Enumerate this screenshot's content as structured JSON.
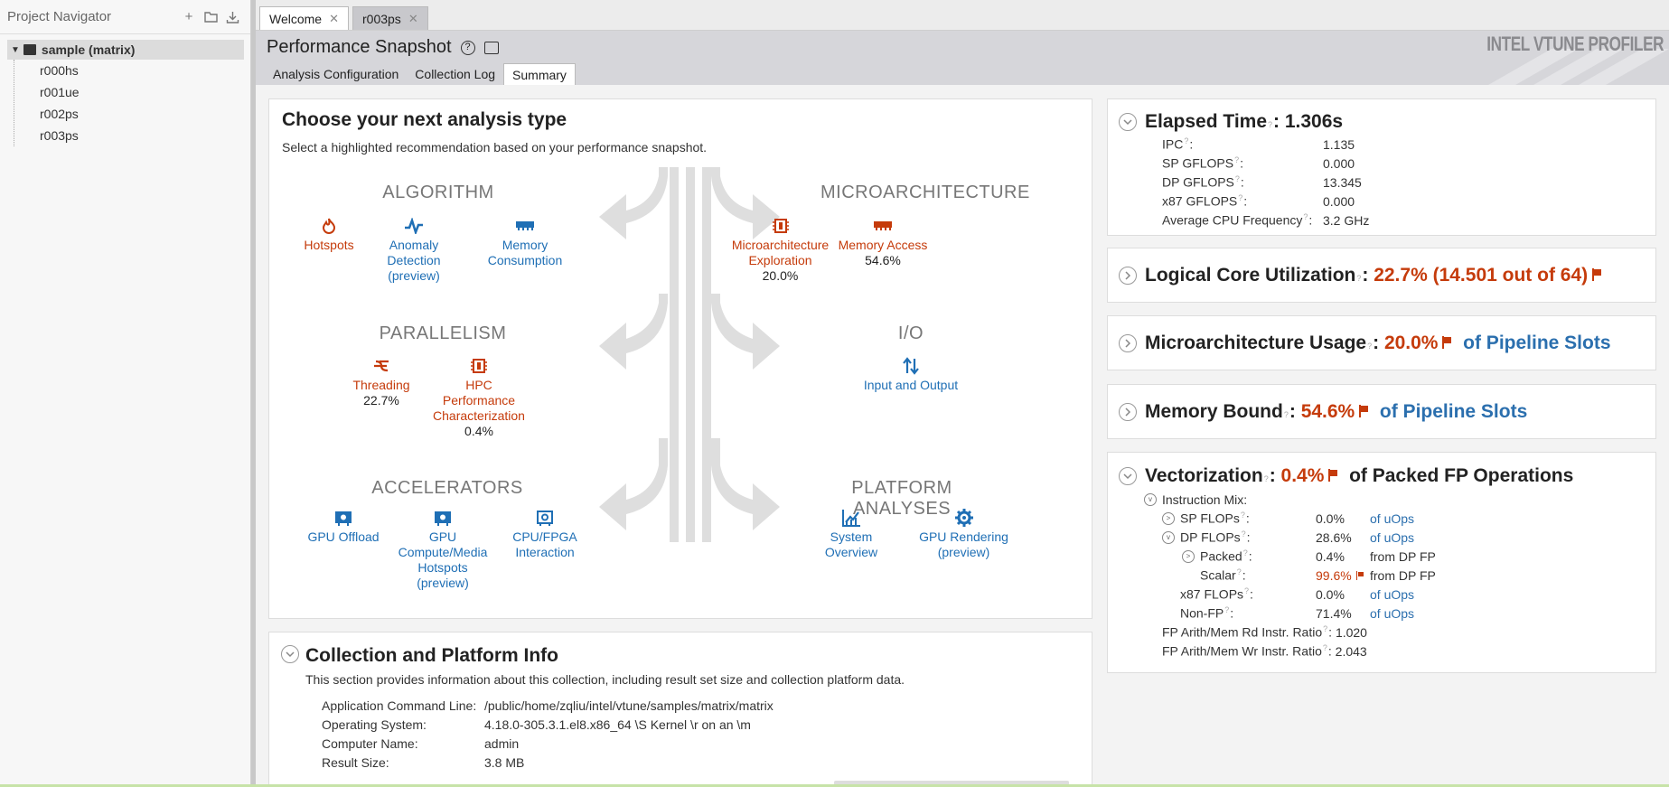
{
  "navigator": {
    "title": "Project Navigator",
    "project": "sample (matrix)",
    "results": [
      "r000hs",
      "r001ue",
      "r002ps",
      "r003ps"
    ]
  },
  "tabs": [
    {
      "label": "Welcome",
      "active": false
    },
    {
      "label": "r003ps",
      "active": true
    }
  ],
  "header": {
    "title": "Performance Snapshot",
    "brand": "INTEL VTUNE PROFILER",
    "subtabs": [
      "Analysis Configuration",
      "Collection Log",
      "Summary"
    ],
    "active_subtab": "Summary"
  },
  "choose": {
    "title": "Choose your next analysis type",
    "subtitle": "Select a highlighted recommendation based on your performance snapshot.",
    "categories": {
      "algorithm": "ALGORITHM",
      "microarchitecture": "MICROARCHITECTURE",
      "parallelism": "PARALLELISM",
      "io": "I/O",
      "accelerators": "ACCELERATORS",
      "platform": "PLATFORM ANALYSES"
    },
    "analyses": {
      "hotspots": {
        "label": "Hotspots",
        "value": ""
      },
      "anomaly": {
        "label": "Anomaly\nDetection\n(preview)",
        "value": ""
      },
      "memory_consumption": {
        "label": "Memory\nConsumption",
        "value": ""
      },
      "uarch_exploration": {
        "label": "Microarchitecture\nExploration",
        "value": "20.0%"
      },
      "memory_access": {
        "label": "Memory Access",
        "value": "54.6%"
      },
      "threading": {
        "label": "Threading",
        "value": "22.7%"
      },
      "hpc": {
        "label": "HPC\nPerformance\nCharacterization",
        "value": "0.4%"
      },
      "io": {
        "label": "Input and Output",
        "value": ""
      },
      "gpu_offload": {
        "label": "GPU Offload",
        "value": ""
      },
      "gpu_compute": {
        "label": "GPU\nCompute/Media\nHotspots\n(preview)",
        "value": ""
      },
      "cpu_fpga": {
        "label": "CPU/FPGA\nInteraction",
        "value": ""
      },
      "system_overview": {
        "label": "System\nOverview",
        "value": ""
      },
      "gpu_rendering": {
        "label": "GPU Rendering\n(preview)",
        "value": ""
      }
    }
  },
  "collection": {
    "title": "Collection and Platform Info",
    "description": "This section provides information about this collection, including result set size and collection platform data.",
    "rows": [
      {
        "k": "Application Command Line:",
        "v": "/public/home/zqliu/intel/vtune/samples/matrix/matrix"
      },
      {
        "k": "Operating System:",
        "v": "4.18.0-305.3.1.el8.x86_64 \\S Kernel \\r on an \\m"
      },
      {
        "k": "Computer Name:",
        "v": "admin"
      },
      {
        "k": "Result Size:",
        "v": "3.8 MB"
      }
    ]
  },
  "elapsed": {
    "title": "Elapsed Time",
    "value": ": 1.306s",
    "metrics": [
      {
        "k": "IPC",
        "v": "1.135"
      },
      {
        "k": "SP GFLOPS",
        "v": "0.000"
      },
      {
        "k": "DP GFLOPS",
        "v": "13.345"
      },
      {
        "k": "x87 GFLOPS",
        "v": "0.000"
      },
      {
        "k": "Average CPU Frequency",
        "v": "3.2 GHz"
      }
    ]
  },
  "logical_core": {
    "title": "Logical Core Utilization",
    "value": "22.7% (14.501 out of 64)"
  },
  "uarch_usage": {
    "title": "Microarchitecture Usage",
    "value": "20.0%",
    "suffix": "of Pipeline Slots"
  },
  "memory_bound": {
    "title": "Memory Bound",
    "value": "54.6%",
    "suffix": "of Pipeline Slots"
  },
  "vectorization": {
    "title": "Vectorization",
    "value": "0.4%",
    "suffix": "of Packed FP Operations",
    "instruction_mix": "Instruction Mix:",
    "rows": [
      {
        "k": "SP FLOPs",
        "v": "0.0%",
        "u": "of uOps"
      },
      {
        "k": "DP FLOPs",
        "v": "28.6%",
        "u": "of uOps"
      },
      {
        "k": "Packed",
        "v": "0.4%",
        "u": "from DP FP"
      },
      {
        "k": "Scalar",
        "v": "99.6%",
        "u": "from DP FP"
      },
      {
        "k": "x87 FLOPs",
        "v": "0.0%",
        "u": "of uOps"
      },
      {
        "k": "Non-FP",
        "v": "71.4%",
        "u": "of uOps"
      },
      {
        "k": "FP Arith/Mem Rd Instr. Ratio",
        "v": "1.020",
        "u": ""
      },
      {
        "k": "FP Arith/Mem Wr Instr. Ratio",
        "v": "2.043",
        "u": ""
      }
    ]
  },
  "colors": {
    "accent_red": "#c53b0b",
    "link_blue": "#1f6fb5"
  }
}
